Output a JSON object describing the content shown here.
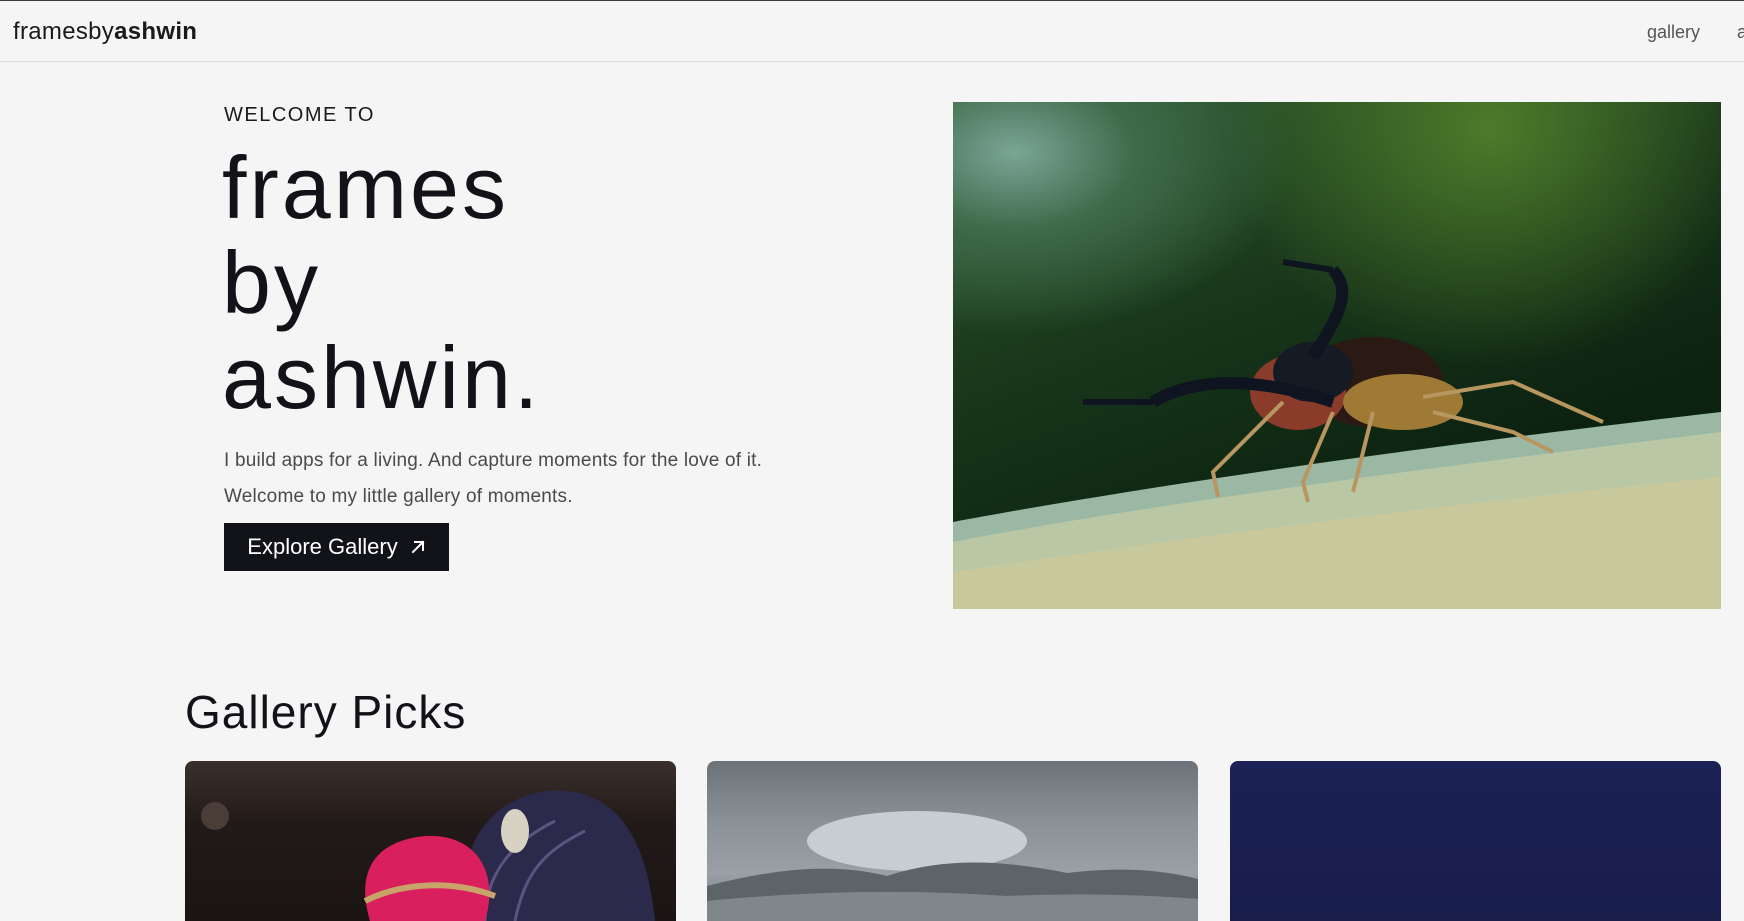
{
  "navbar": {
    "brand_light": "framesby",
    "brand_bold": "ashwin",
    "links": [
      "gallery",
      "a"
    ]
  },
  "hero": {
    "eyebrow": "WELCOME TO",
    "title_lines": [
      "frames",
      "by",
      "ashwin."
    ],
    "tagline_lines": [
      "I build apps for a living. And capture moments for the love of it.",
      "Welcome to my little gallery of moments."
    ],
    "cta_label": "Explore Gallery",
    "cta_icon": "arrow-up-right-icon",
    "image_subject": "jumping spider macro"
  },
  "gallery_picks": {
    "title": "Gallery Picks",
    "cards": [
      {
        "subject": "pink turban with fan"
      },
      {
        "subject": "cloudy mountains"
      },
      {
        "subject": "night sky"
      }
    ]
  },
  "colors": {
    "background": "#f5f5f5",
    "text": "#111318",
    "button_bg": "#111318",
    "button_text": "#ffffff",
    "muted_text": "#4a4a4a"
  }
}
